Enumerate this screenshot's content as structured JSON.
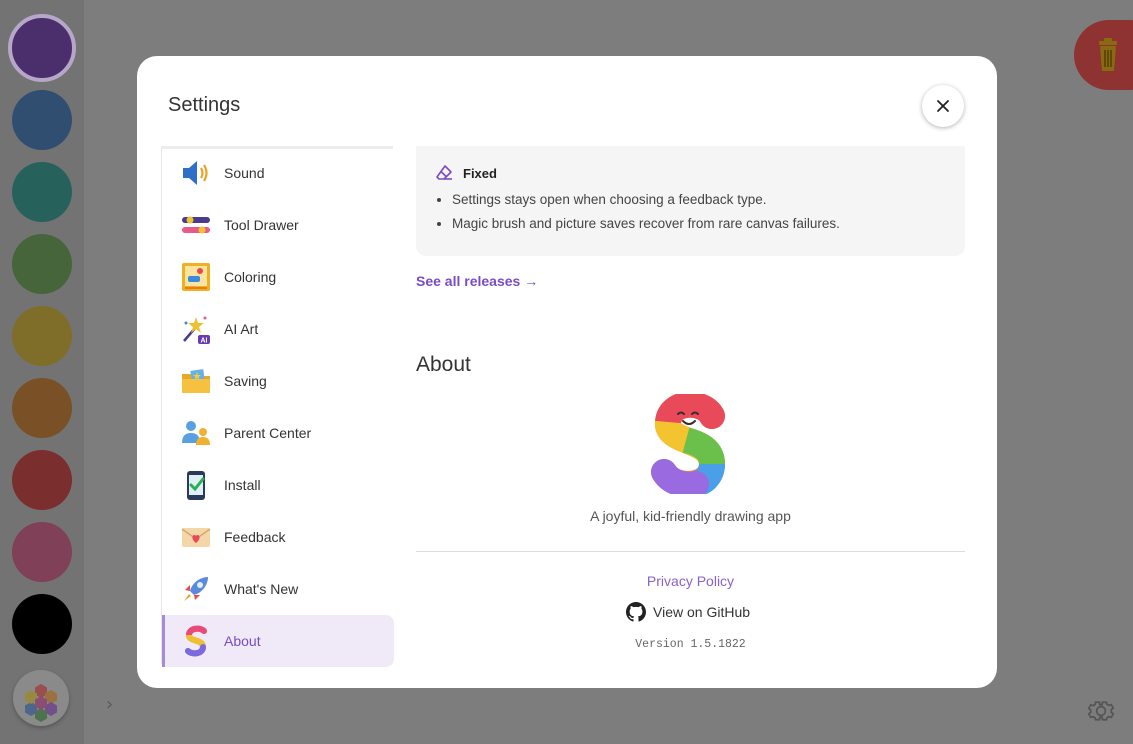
{
  "palette": {
    "swatches": [
      {
        "color": "#4a2f6c",
        "selected": true
      },
      {
        "color": "#2f4e70"
      },
      {
        "color": "#27615c"
      },
      {
        "color": "#47653a"
      },
      {
        "color": "#7f6d2a"
      },
      {
        "color": "#7a5027"
      },
      {
        "color": "#7a2e2e"
      },
      {
        "color": "#7f4058"
      },
      {
        "color": "#000000"
      }
    ]
  },
  "modal": {
    "title": "Settings",
    "close_icon": "close-icon"
  },
  "nav": {
    "items": [
      {
        "label": "Sound",
        "icon": "speaker-icon"
      },
      {
        "label": "Tool Drawer",
        "icon": "toggles-icon"
      },
      {
        "label": "Coloring",
        "icon": "coloring-book-icon"
      },
      {
        "label": "AI Art",
        "icon": "magic-wand-icon"
      },
      {
        "label": "Saving",
        "icon": "folder-icon"
      },
      {
        "label": "Parent Center",
        "icon": "people-icon"
      },
      {
        "label": "Install",
        "icon": "phone-install-icon"
      },
      {
        "label": "Feedback",
        "icon": "envelope-heart-icon"
      },
      {
        "label": "What's New",
        "icon": "rocket-icon"
      },
      {
        "label": "About",
        "icon": "rainbow-s-icon",
        "active": true
      }
    ]
  },
  "release": {
    "fixed_heading": "Fixed",
    "fixed_icon": "eraser-icon",
    "fixes": [
      "Settings stays open when choosing a feedback type.",
      "Magic brush and picture saves recover from rare canvas failures."
    ],
    "see_all": "See all releases →"
  },
  "about": {
    "heading": "About",
    "tagline": "A joyful, kid-friendly drawing app",
    "privacy": "Privacy Policy",
    "github": "View on GitHub",
    "version": "Version 1.5.1822"
  },
  "accent_color": "#7a4cc4"
}
